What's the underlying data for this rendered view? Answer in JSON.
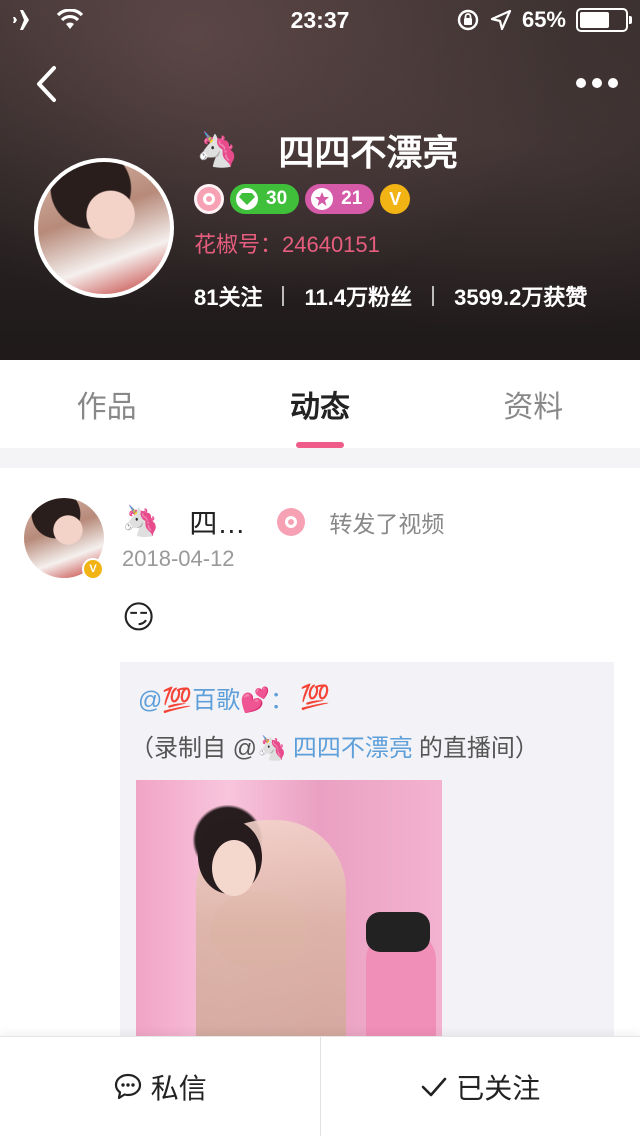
{
  "status_bar": {
    "time": "23:37",
    "battery_percent": "65%",
    "battery_level": 0.65
  },
  "profile": {
    "name": "四四不漂亮",
    "name_emoji": "🦄",
    "badges": {
      "level_green": "30",
      "level_pink": "21",
      "verified": "V"
    },
    "huajiao_id": "花椒号：24640151",
    "stats": {
      "following": "81关注",
      "fans": "11.4万粉丝",
      "likes": "3599.2万获赞"
    },
    "colors": {
      "accent_pink": "#ef5c8a",
      "id_pink": "#e65d7d",
      "green_badge": "#3fbf3a",
      "pink_badge": "#d55aa8",
      "gold_v": "#f2b415",
      "link_blue": "#5e9fd9"
    }
  },
  "tabs": [
    {
      "label": "作品",
      "active": false
    },
    {
      "label": "动态",
      "active": true
    },
    {
      "label": "资料",
      "active": false
    }
  ],
  "feed": {
    "post": {
      "author_emoji": "🦄",
      "author_name": "四…",
      "action": "转发了视频",
      "date": "2018-04-12",
      "content_emoji": "😏",
      "repost": {
        "mention": "@💯百歌💕：",
        "mention_tail": "💯",
        "source_prefix": "（录制自 @🦄",
        "source_link": "四四不漂亮",
        "source_suffix": "的直播间）"
      }
    }
  },
  "bottom_bar": {
    "message_label": "私信",
    "follow_label": "已关注"
  },
  "icons": {
    "airplane": "airplane-icon",
    "wifi": "wifi-icon",
    "rotation_lock": "rotation-lock-icon",
    "location": "location-arrow-icon",
    "back": "chevron-left-icon",
    "more": "more-dots-icon",
    "chat": "chat-bubble-icon",
    "check": "check-icon"
  }
}
